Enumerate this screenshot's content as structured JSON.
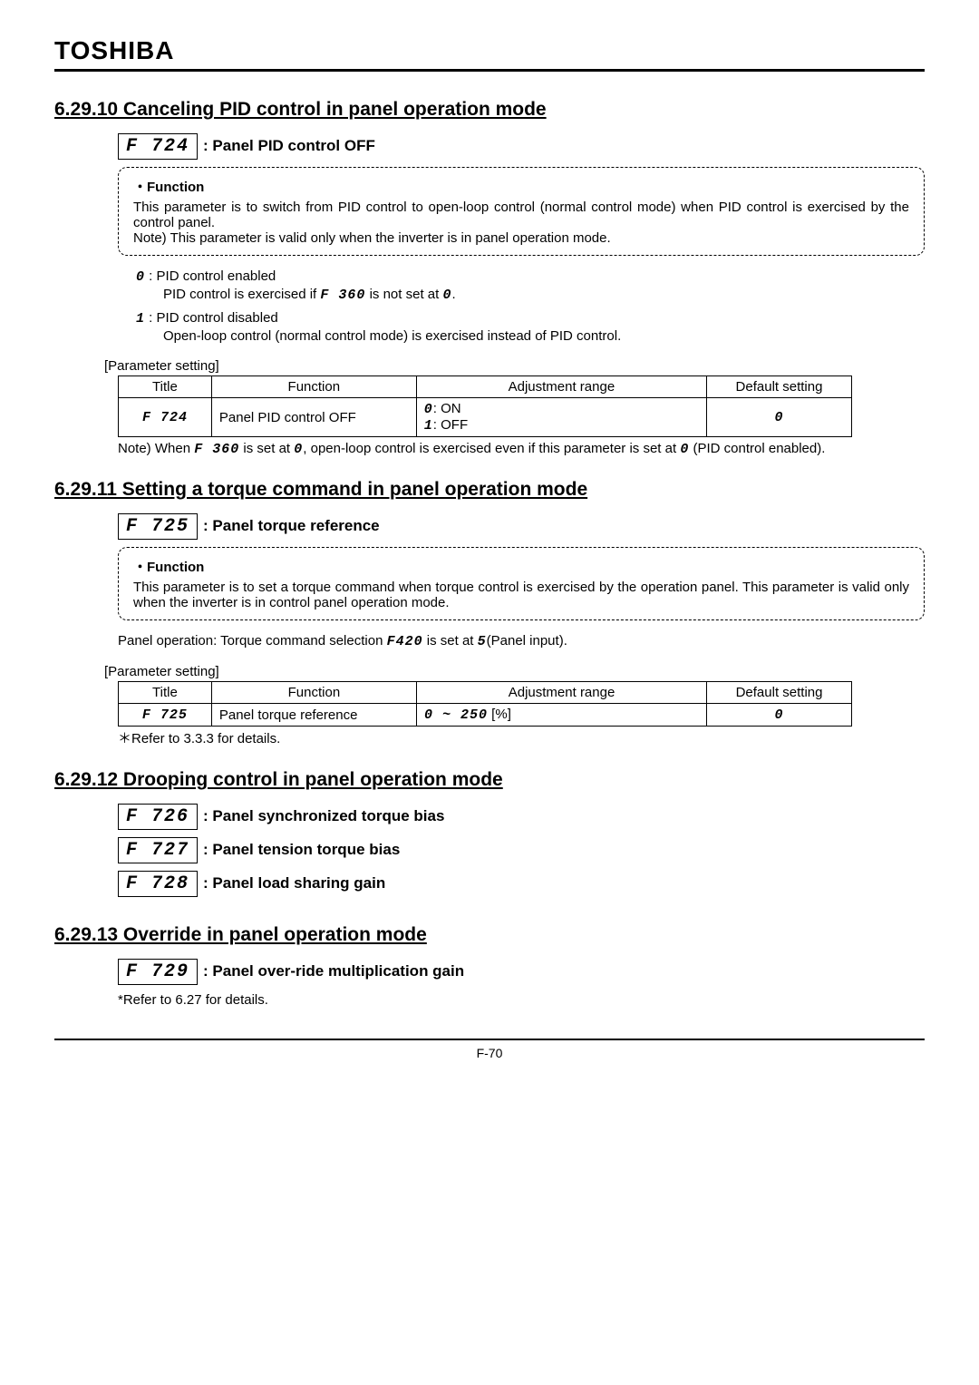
{
  "brand": "TOSHIBA",
  "sections": {
    "s1": {
      "heading": "6.29.10  Canceling  PID  control  in  panel  operation  mode",
      "param_code": "F 724",
      "param_title": ": Panel  PID  control  OFF",
      "function_label": "Function",
      "function_text": "This  parameter  is  to  switch  from  PID  control  to  open-loop  control  (normal  control  mode)  when  PID  control  is  exercised  by  the  control  panel.",
      "function_note": "Note)  This  parameter  is  valid  only  when  the  inverter  is  in  panel  operation  mode.",
      "opt0_code": "0",
      "opt0_label": " :  PID  control  enabled",
      "opt0_sub_a": "PID  control  is  exercised  if  ",
      "opt0_sub_code": "F 360",
      "opt0_sub_b": "  is  not  set  at  ",
      "opt0_sub_zero": "0",
      "opt0_sub_c": ".",
      "opt1_code": "1",
      "opt1_label": " :  PID  control  disabled",
      "opt1_sub": "Open-loop  control  (normal  control  mode)  is  exercised  instead  of  PID  control.",
      "table": {
        "header": [
          "Title",
          "Function",
          "Adjustment range",
          "Default setting"
        ],
        "row": {
          "title": "F 724",
          "func": "Panel  PID  control  OFF",
          "range_line1_code": "0",
          "range_line1_text": ":  ON",
          "range_line2_code": "1",
          "range_line2_text": ":  OFF",
          "default": "0"
        }
      },
      "note_a": "Note)  When  ",
      "note_code1": "F 360",
      "note_b": "  is  set  at  ",
      "note_zero1": "0",
      "note_c": ",  open-loop  control  is  exercised  even  if  this  parameter  is  set  at  ",
      "note_zero2": "0",
      "note_d": "  (PID  control  enabled)."
    },
    "s2": {
      "heading": "6.29.11  Setting  a  torque  command  in  panel  operation  mode",
      "param_code": "F 725",
      "param_title": ": Panel  torque  reference",
      "function_label": "Function",
      "function_text": "This  parameter  is  to  set  a  torque  command  when  torque  control  is  exercised  by  the  operation  panel.    This  parameter  is  valid  only  when  the  inverter  is  in  control  panel  operation  mode.",
      "panel_op_a": "Panel  operation:  Torque  command  selection  ",
      "panel_op_code": "F420",
      "panel_op_b": "  is  set  at  ",
      "panel_op_val": "5",
      "panel_op_c": "(Panel  input).",
      "table": {
        "header": [
          "Title",
          "Function",
          "Adjustment range",
          "Default setting"
        ],
        "row": {
          "title": "F 725",
          "func": "Panel  torque  reference",
          "range_code": "0 ~ 250",
          "range_unit": "  [%]",
          "default": "0"
        }
      },
      "note": "＊Refer  to  3.3.3  for  details."
    },
    "s3": {
      "heading": "6.29.12  Drooping  control  in  panel  operation  mode",
      "p1_code": "F 726",
      "p1_title": ": Panel  synchronized  torque  bias",
      "p2_code": "F 727",
      "p2_title": ": Panel  tension  torque  bias",
      "p3_code": "F 728",
      "p3_title": ": Panel  load  sharing  gain"
    },
    "s4": {
      "heading": "6.29.13  Override  in  panel  operation  mode",
      "param_code": "F 729",
      "param_title": ": Panel  over-ride  multiplication  gain",
      "note": "*Refer  to  6.27  for  details."
    }
  },
  "parameter_setting_label": "[Parameter  setting]",
  "footer": "F-70"
}
